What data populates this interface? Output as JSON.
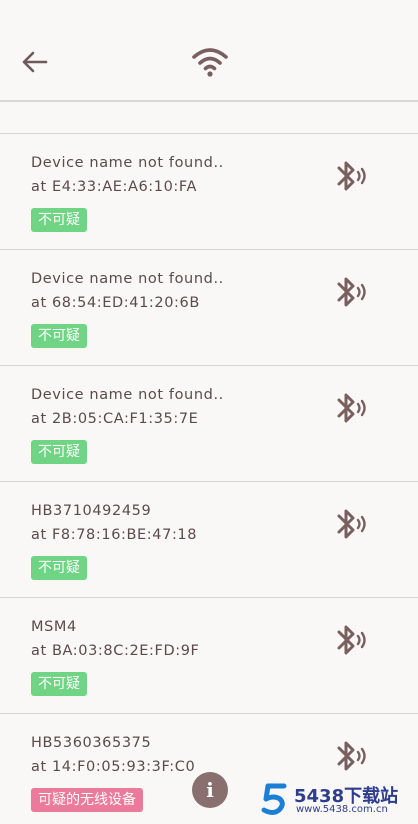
{
  "header": {
    "back_icon": "arrow-left-icon",
    "center_icon": "wifi-icon"
  },
  "devices": [
    {
      "name": "Device name not found..",
      "address": "at E4:33:AE:A6:10:FA",
      "tag": "不可疑",
      "status": "safe",
      "icon": "bluetooth-audio-icon"
    },
    {
      "name": "Device name not found..",
      "address": "at 68:54:ED:41:20:6B",
      "tag": "不可疑",
      "status": "safe",
      "icon": "bluetooth-audio-icon"
    },
    {
      "name": "Device name not found..",
      "address": "at 2B:05:CA:F1:35:7E",
      "tag": "不可疑",
      "status": "safe",
      "icon": "bluetooth-audio-icon"
    },
    {
      "name": "HB3710492459",
      "address": "at F8:78:16:BE:47:18",
      "tag": "不可疑",
      "status": "safe",
      "icon": "bluetooth-audio-icon"
    },
    {
      "name": "MSM4",
      "address": "at BA:03:8C:2E:FD:9F",
      "tag": "不可疑",
      "status": "safe",
      "icon": "bluetooth-audio-icon"
    },
    {
      "name": "HB5360365375",
      "address": "at 14:F0:05:93:3F:C0",
      "tag": "可疑的无线设备",
      "status": "suspicious",
      "icon": "bluetooth-audio-icon"
    }
  ],
  "fab": {
    "label": "i",
    "icon": "info-icon"
  },
  "watermark": {
    "title": "5438下载站",
    "url": "www.5438.com.cn"
  },
  "colors": {
    "background": "#faf7f7",
    "text": "#5b4b4b",
    "icon": "#7a5f5f",
    "safe_badge": "#6fd483",
    "suspicious_badge": "#ec7a9c",
    "fab": "#8a6f6f"
  }
}
